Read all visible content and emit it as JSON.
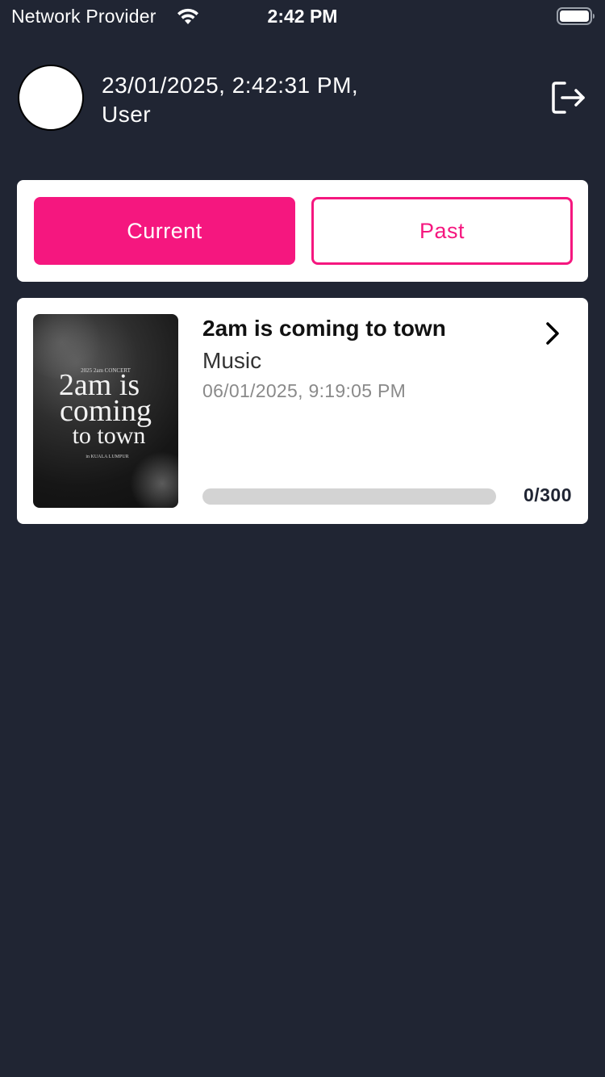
{
  "status_bar": {
    "carrier": "Network Provider",
    "time": "2:42 PM",
    "wifi_icon": "wifi-icon",
    "battery_icon": "battery-full-icon"
  },
  "header": {
    "datetime": "23/01/2025, 2:42:31 PM,",
    "username": "User",
    "logout_icon": "logout-icon"
  },
  "tabs": {
    "current_label": "Current",
    "past_label": "Past",
    "selected": "Current"
  },
  "events": [
    {
      "title": "2am is coming to town",
      "category": "Music",
      "datetime": "06/01/2025, 9:19:05 PM",
      "poster": {
        "line_top": "2025 2am CONCERT",
        "line_main1": "2am is",
        "line_main2": "coming",
        "line_main3": "to town",
        "line_bottom": "in KUALA LUMPUR"
      },
      "progress": {
        "current": 0,
        "total": 300,
        "label": "0/300"
      }
    }
  ],
  "colors": {
    "background": "#202533",
    "accent": "#f5177f",
    "card": "#ffffff",
    "progress_track": "#d3d3d3"
  }
}
